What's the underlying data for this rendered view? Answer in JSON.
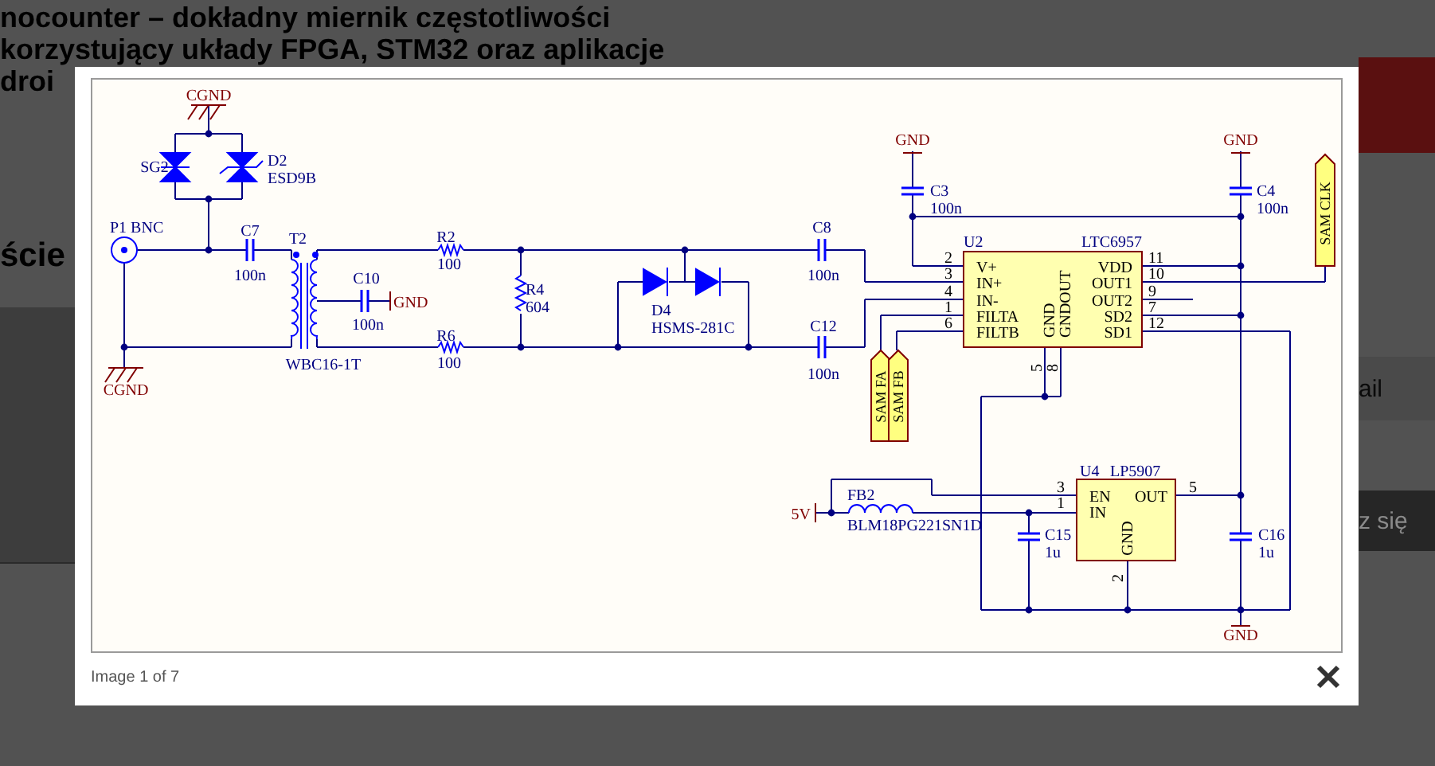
{
  "background": {
    "heading_lines": [
      "nocounter – dokładny miernik częstotliwości",
      "korzystujący układy FPGA, STM32 oraz aplikacje",
      "droi"
    ],
    "section_heading": "ście",
    "field_text": "ail",
    "button_text": "z się"
  },
  "lightbox": {
    "schematic": {
      "labels": [
        {
          "text": "CGND",
          "kind": "power"
        },
        {
          "text": "SG2",
          "kind": "ref"
        },
        {
          "text": "D2",
          "kind": "ref"
        },
        {
          "text": "ESD9B",
          "kind": "value"
        },
        {
          "text": "P1 BNC",
          "kind": "ref"
        },
        {
          "text": "C7",
          "kind": "ref"
        },
        {
          "text": "100n",
          "kind": "value"
        },
        {
          "text": "T2",
          "kind": "ref"
        },
        {
          "text": "C10",
          "kind": "ref"
        },
        {
          "text": "100n",
          "kind": "value"
        },
        {
          "text": "GND",
          "kind": "power"
        },
        {
          "text": "CGND",
          "kind": "power"
        },
        {
          "text": "WBC16-1T",
          "kind": "value"
        },
        {
          "text": "R2",
          "kind": "ref"
        },
        {
          "text": "100",
          "kind": "value"
        },
        {
          "text": "R6",
          "kind": "ref"
        },
        {
          "text": "100",
          "kind": "value"
        },
        {
          "text": "R4",
          "kind": "ref"
        },
        {
          "text": "604",
          "kind": "value"
        },
        {
          "text": "D4",
          "kind": "ref"
        },
        {
          "text": "HSMS-281C",
          "kind": "value"
        },
        {
          "text": "C8",
          "kind": "ref"
        },
        {
          "text": "100n",
          "kind": "value"
        },
        {
          "text": "C12",
          "kind": "ref"
        },
        {
          "text": "100n",
          "kind": "value"
        },
        {
          "text": "GND",
          "kind": "power"
        },
        {
          "text": "C3",
          "kind": "ref"
        },
        {
          "text": "100n",
          "kind": "value"
        },
        {
          "text": "GND",
          "kind": "power"
        },
        {
          "text": "C4",
          "kind": "ref"
        },
        {
          "text": "100n",
          "kind": "value"
        },
        {
          "text": "U2",
          "kind": "ref"
        },
        {
          "text": "LTC6957",
          "kind": "value"
        },
        {
          "text": "V+",
          "kind": "pin_name"
        },
        {
          "text": "IN+",
          "kind": "pin_name"
        },
        {
          "text": "IN-",
          "kind": "pin_name"
        },
        {
          "text": "FILTA",
          "kind": "pin_name"
        },
        {
          "text": "FILTB",
          "kind": "pin_name"
        },
        {
          "text": "VDD",
          "kind": "pin_name"
        },
        {
          "text": "OUT1",
          "kind": "pin_name"
        },
        {
          "text": "OUT2",
          "kind": "pin_name"
        },
        {
          "text": "SD2",
          "kind": "pin_name"
        },
        {
          "text": "SD1",
          "kind": "pin_name"
        },
        {
          "text": "GND",
          "kind": "pin_name"
        },
        {
          "text": "GNDOUT",
          "kind": "pin_name"
        },
        {
          "text": "2",
          "kind": "pin_number"
        },
        {
          "text": "3",
          "kind": "pin_number"
        },
        {
          "text": "4",
          "kind": "pin_number"
        },
        {
          "text": "1",
          "kind": "pin_number"
        },
        {
          "text": "6",
          "kind": "pin_number"
        },
        {
          "text": "11",
          "kind": "pin_number"
        },
        {
          "text": "10",
          "kind": "pin_number"
        },
        {
          "text": "9",
          "kind": "pin_number"
        },
        {
          "text": "7",
          "kind": "pin_number"
        },
        {
          "text": "12",
          "kind": "pin_number"
        },
        {
          "text": "5",
          "kind": "pin_number"
        },
        {
          "text": "8",
          "kind": "pin_number"
        },
        {
          "text": "SAM CLK",
          "kind": "net"
        },
        {
          "text": "SAM FA",
          "kind": "net"
        },
        {
          "text": "SAM FB",
          "kind": "net"
        },
        {
          "text": "U4",
          "kind": "ref"
        },
        {
          "text": "LP5907",
          "kind": "value"
        },
        {
          "text": "EN",
          "kind": "pin_name"
        },
        {
          "text": "IN",
          "kind": "pin_name"
        },
        {
          "text": "OUT",
          "kind": "pin_name"
        },
        {
          "text": "GND",
          "kind": "pin_name"
        },
        {
          "text": "3",
          "kind": "pin_number"
        },
        {
          "text": "1",
          "kind": "pin_number"
        },
        {
          "text": "5",
          "kind": "pin_number"
        },
        {
          "text": "2",
          "kind": "pin_number"
        },
        {
          "text": "5V",
          "kind": "power"
        },
        {
          "text": "FB2",
          "kind": "ref"
        },
        {
          "text": "BLM18PG221SN1D",
          "kind": "value"
        },
        {
          "text": "C15",
          "kind": "ref"
        },
        {
          "text": "1u",
          "kind": "value"
        },
        {
          "text": "C16",
          "kind": "ref"
        },
        {
          "text": "1u",
          "kind": "value"
        },
        {
          "text": "GND",
          "kind": "power"
        }
      ]
    },
    "caption": "Image 1 of 7"
  }
}
